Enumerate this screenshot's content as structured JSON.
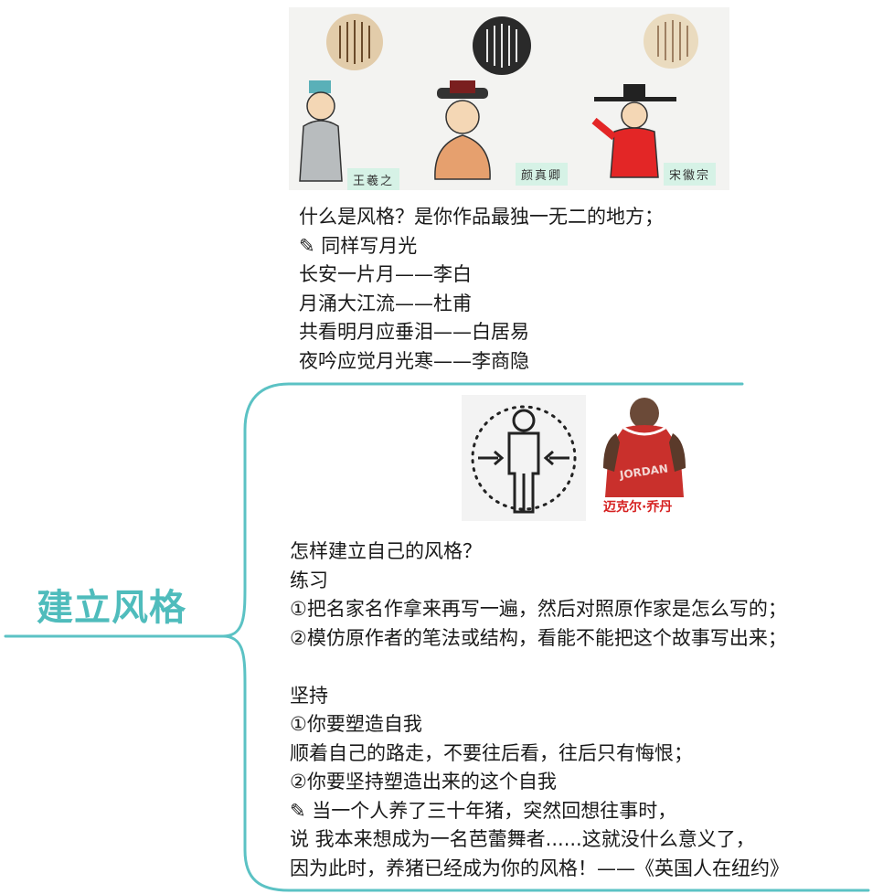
{
  "root": {
    "title": "建立风格"
  },
  "node1": {
    "images": {
      "calligraphers": [
        {
          "name": "王羲之"
        },
        {
          "name": "颜真卿"
        },
        {
          "name": "宋徽宗"
        }
      ]
    },
    "lines": [
      "什么是风格？是你作品最独一无二的地方；",
      "✎ 同样写月光",
      "长安一片月——李白",
      "月涌大江流——杜甫",
      "共看明月应垂泪——白居易",
      "夜吟应觉月光寒——李商隐"
    ]
  },
  "node2": {
    "images": {
      "jordan_caption": "迈克尔·乔丹"
    },
    "lines": [
      "怎样建立自己的风格？",
      "练习",
      "①把名家名作拿来再写一遍，然后对照原作家是怎么写的；",
      "②模仿原作者的笔法或结构，看能不能把这个故事写出来；",
      "",
      "坚持",
      "①你要塑造自我",
      "顺着自己的路走，不要往后看，往后只有悔恨；",
      "②你要坚持塑造出来的这个自我",
      "✎ 当一个人养了三十年猪，突然回想往事时，",
      "说 我本来想成为一名芭蕾舞者......这就没什么意义了，",
      "因为此时，养猪已经成为你的风格！——《英国人在纽约》"
    ]
  },
  "colors": {
    "connector": "#5bc2c4",
    "title": "#4fbcbc",
    "stamp": "#d6f2e6",
    "jersey": "#c9302c"
  }
}
